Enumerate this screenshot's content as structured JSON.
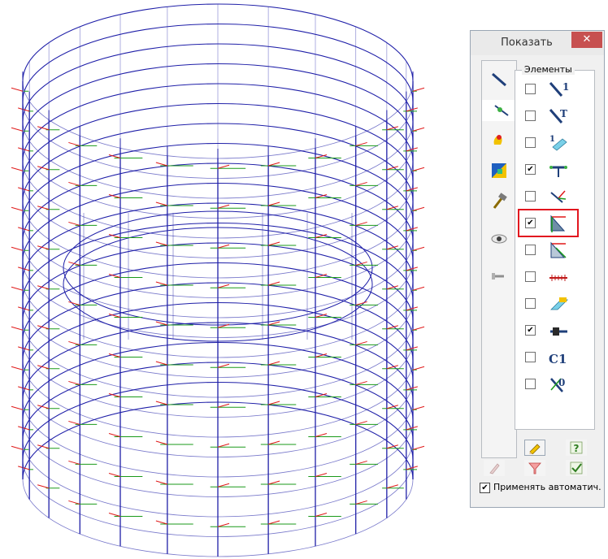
{
  "window": {
    "title": "Показать",
    "close_label": "✕"
  },
  "tabs": [
    {
      "icon": "bar-element-icon",
      "active": false
    },
    {
      "icon": "node-element-icon",
      "active": true
    },
    {
      "icon": "load-icon",
      "active": false
    },
    {
      "icon": "colormap-icon",
      "active": false
    },
    {
      "icon": "hammer-icon",
      "active": false
    },
    {
      "icon": "eye-icon",
      "active": false
    },
    {
      "icon": "wrench-icon",
      "active": false
    }
  ],
  "elements_group": {
    "label": "Элементы",
    "items": [
      {
        "icon": "element-number-icon",
        "checked": false,
        "glyph": "1"
      },
      {
        "icon": "element-type-icon",
        "checked": false,
        "glyph": "T"
      },
      {
        "icon": "stiffness-type-icon",
        "checked": false,
        "glyph": "1"
      },
      {
        "icon": "section-orientation-icon",
        "checked": true,
        "glyph": ""
      },
      {
        "icon": "local-axes-icon",
        "checked": false,
        "glyph": ""
      },
      {
        "icon": "plate-local-axes-icon",
        "checked": true,
        "glyph": ""
      },
      {
        "icon": "plate-axes-outline-icon",
        "checked": false,
        "glyph": ""
      },
      {
        "icon": "dimension-line-icon",
        "checked": false,
        "glyph": ""
      },
      {
        "icon": "extruded-section-icon",
        "checked": false,
        "glyph": ""
      },
      {
        "icon": "rigid-insert-icon",
        "checked": true,
        "glyph": ""
      },
      {
        "icon": "construction-label-icon",
        "checked": false,
        "glyph": "C1"
      },
      {
        "icon": "zero-elements-icon",
        "checked": false,
        "glyph": "0"
      }
    ]
  },
  "bottom_buttons": [
    "pencil-icon",
    "help-icon",
    "brush-icon",
    "filter-icon",
    "apply-check-icon"
  ],
  "auto_apply": {
    "label": "Применять автоматич.",
    "checked": true
  },
  "colors": {
    "mesh_blue": "#1f1fa8",
    "axis_red": "#e01818",
    "axis_green": "#1a9a1a",
    "highlight_red": "#e2161f",
    "close_red": "#c75050"
  }
}
